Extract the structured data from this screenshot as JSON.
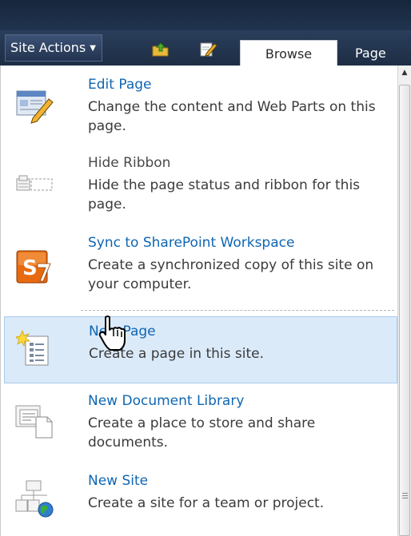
{
  "ribbon": {
    "site_actions_label": "Site Actions",
    "tabs": [
      {
        "label": "Browse",
        "selected": true
      },
      {
        "label": "Page",
        "selected": false
      }
    ],
    "icons": [
      "navigate-up-icon",
      "edit-page-icon"
    ]
  },
  "menu": {
    "items": [
      {
        "title": "Edit Page",
        "description": "Change the content and Web Parts on this page.",
        "icon": "edit-page-icon",
        "enabled": true
      },
      {
        "title": "Hide Ribbon",
        "description": "Hide the page status and ribbon for this page.",
        "icon": "hide-ribbon-icon",
        "enabled": false
      },
      {
        "title": "Sync to SharePoint Workspace",
        "description": "Create a synchronized copy of this site on your computer.",
        "icon": "sharepoint-workspace-icon",
        "enabled": true
      },
      {
        "title": "New Page",
        "description": "Create a page in this site.",
        "icon": "new-page-icon",
        "enabled": true,
        "hovered": true
      },
      {
        "title": "New Document Library",
        "description": "Create a place to store and share documents.",
        "icon": "new-document-library-icon",
        "enabled": true
      },
      {
        "title": "New Site",
        "description": "Create a site for a team or project.",
        "icon": "new-site-icon",
        "enabled": true
      }
    ]
  },
  "colors": {
    "ribbon_bg": "#21344f",
    "link_blue": "#0f66b2",
    "hover_bg": "#dbeaf9"
  }
}
